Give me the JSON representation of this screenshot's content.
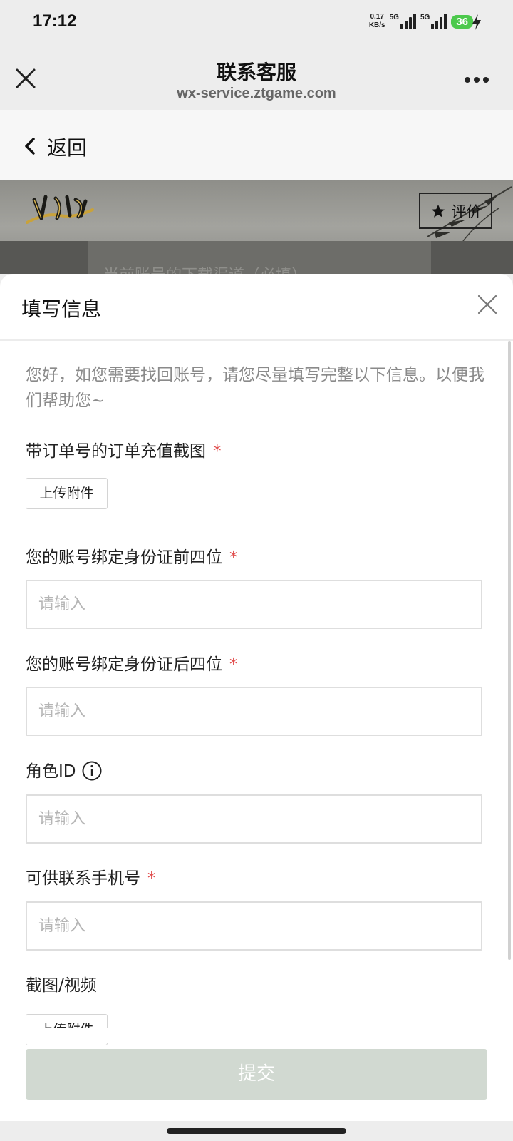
{
  "status_bar": {
    "time": "17:12",
    "net_speed_value": "0.17",
    "net_speed_unit": "KB/s",
    "signal1_tag": "5G",
    "signal2_tag": "5G",
    "battery": "36",
    "battery_color": "#4cc94c"
  },
  "title_bar": {
    "title": "联系客服",
    "subtitle": "wx-service.ztgame.com"
  },
  "back": {
    "label": "返回"
  },
  "banner": {
    "rate_label": "评价",
    "card_text": "当前账号的下载渠道（必填）"
  },
  "sheet": {
    "title": "填写信息",
    "intro": "您好，如您需要找回账号，请您尽量填写完整以下信息。以便我们帮助您~",
    "fields": [
      {
        "label": "带订单号的订单充值截图",
        "required_mark": "*",
        "button": "上传附件"
      },
      {
        "label": "您的账号绑定身份证前四位",
        "required_mark": "*",
        "placeholder": "请输入"
      },
      {
        "label": "您的账号绑定身份证后四位",
        "required_mark": "*",
        "placeholder": "请输入"
      },
      {
        "label": "角色ID",
        "placeholder": "请输入"
      },
      {
        "label": "可供联系手机号",
        "required_mark": "*",
        "placeholder": "请输入"
      },
      {
        "label": "截图/视频",
        "button": "上传附件"
      }
    ],
    "submit": "提交",
    "accent_required": "#e04a4a",
    "submit_color": "#d1d9d1"
  }
}
